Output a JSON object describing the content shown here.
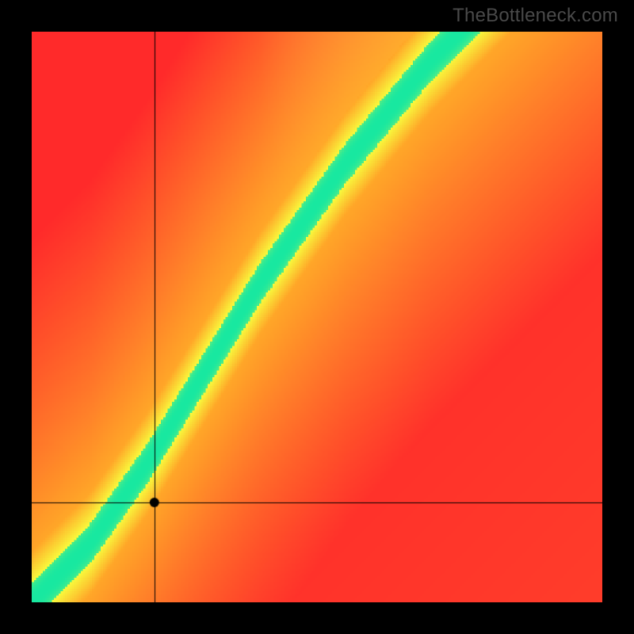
{
  "watermark": "TheBottleneck.com",
  "chart_data": {
    "type": "heatmap",
    "title": "",
    "xlabel": "",
    "ylabel": "",
    "x_range": [
      0,
      1
    ],
    "y_range": [
      0,
      1
    ],
    "grid_resolution": 128,
    "optimal_curve": {
      "comment": "green band centerline y = f(x); approximated piecewise",
      "points": [
        [
          0.0,
          0.0
        ],
        [
          0.05,
          0.05
        ],
        [
          0.1,
          0.1
        ],
        [
          0.15,
          0.17
        ],
        [
          0.2,
          0.24
        ],
        [
          0.25,
          0.32
        ],
        [
          0.3,
          0.4
        ],
        [
          0.35,
          0.48
        ],
        [
          0.4,
          0.56
        ],
        [
          0.45,
          0.63
        ],
        [
          0.5,
          0.7
        ],
        [
          0.55,
          0.77
        ],
        [
          0.6,
          0.83
        ],
        [
          0.65,
          0.89
        ],
        [
          0.7,
          0.95
        ],
        [
          0.75,
          1.0
        ]
      ]
    },
    "band_half_width": 0.035,
    "yellow_halo_half_width": 0.09,
    "crosshair": {
      "x": 0.215,
      "y": 0.175
    },
    "marker": {
      "x": 0.215,
      "y": 0.175,
      "radius_px": 6
    },
    "colors": {
      "optimal": "#18E8A0",
      "near": "#F8F83C",
      "warm": "#FFA628",
      "bad": "#FF2A2A",
      "cool_corner": "#FFF26A",
      "crosshair": "#000000",
      "marker": "#000000"
    }
  }
}
